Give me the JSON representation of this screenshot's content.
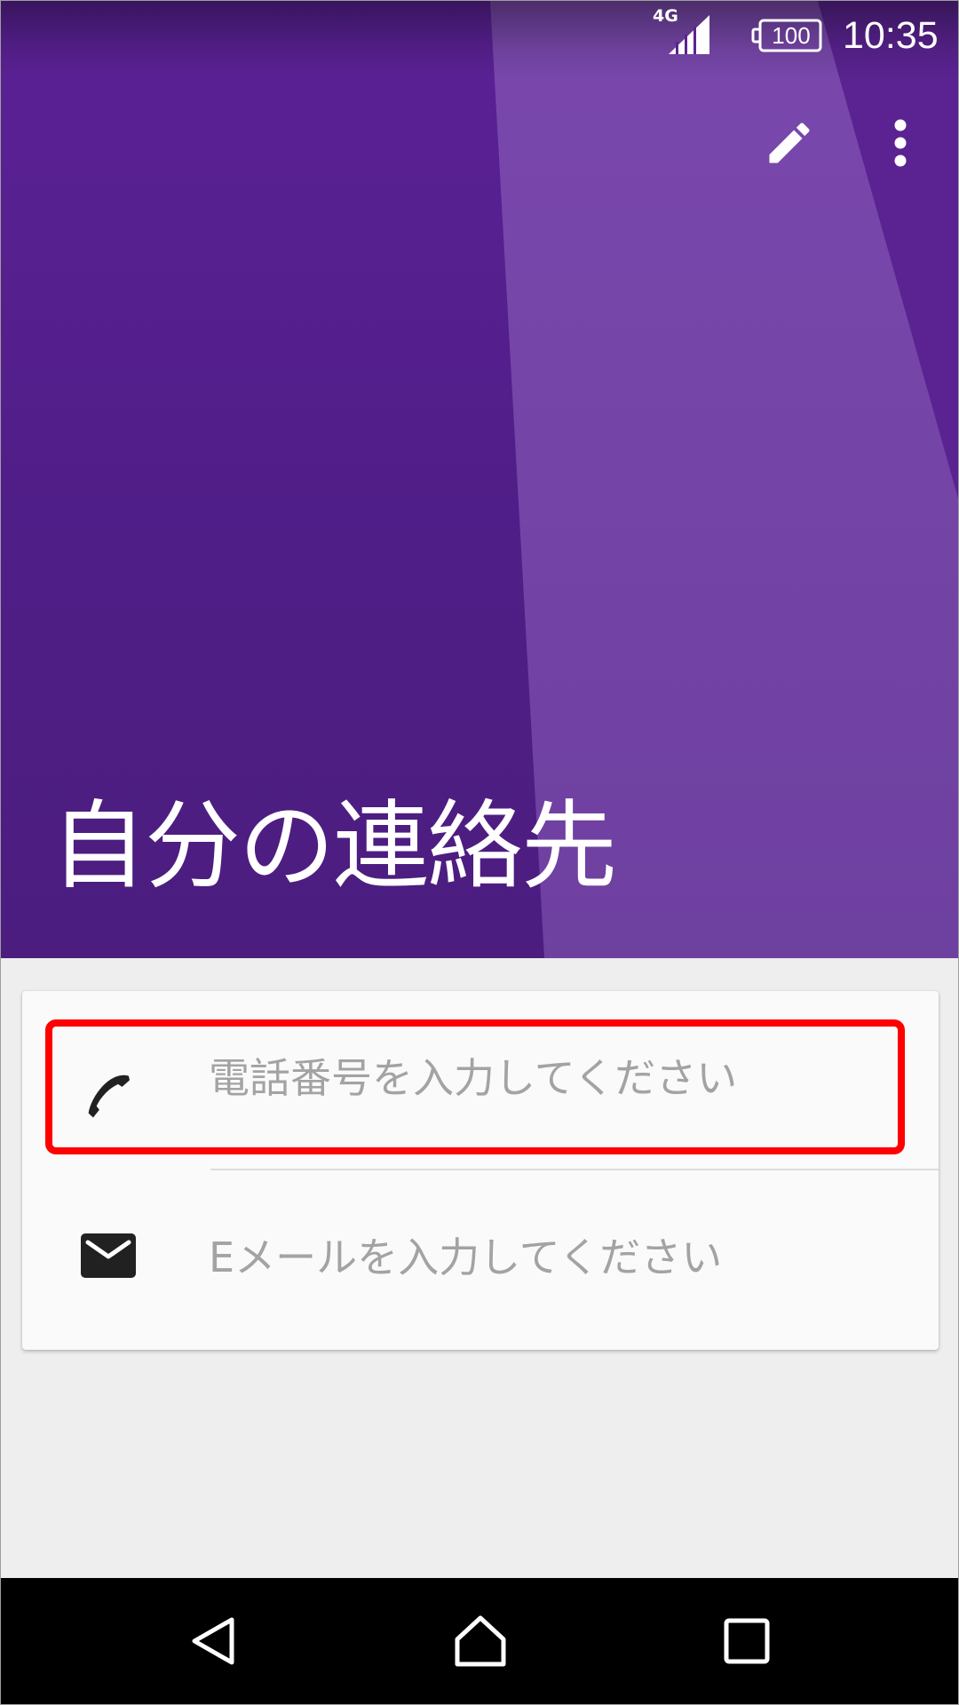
{
  "status_bar": {
    "network_type": "4G",
    "battery_level": "100",
    "time": "10:35"
  },
  "header": {
    "title": "自分の連絡先",
    "actions": [
      {
        "icon": "edit-icon"
      },
      {
        "icon": "more-vert-icon"
      }
    ]
  },
  "card": {
    "phone": {
      "icon": "phone-icon",
      "placeholder": "電話番号を入力してください",
      "value": ""
    },
    "email": {
      "icon": "email-icon",
      "placeholder": "Eメールを入力してください",
      "value": ""
    }
  },
  "annotation": {
    "highlight_color": "#ff0000",
    "highlighted_field": "phone"
  },
  "navigation_bar": {
    "buttons": [
      {
        "icon": "back-icon"
      },
      {
        "icon": "home-icon"
      },
      {
        "icon": "recents-icon"
      }
    ]
  },
  "colors": {
    "header_dark": "#4f1e86",
    "header_light": "#7446a8",
    "background": "#eeeeee",
    "card": "#fafafa",
    "placeholder_text": "#a3a3a3"
  }
}
